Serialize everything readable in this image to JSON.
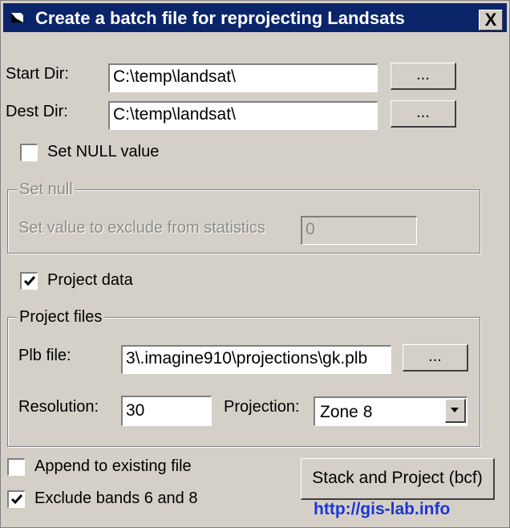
{
  "window": {
    "title": "Create a batch file for reprojecting Landsats",
    "close_label": "X"
  },
  "start_dir": {
    "label": "Start Dir:",
    "value": "C:\\temp\\landsat\\",
    "browse_label": "..."
  },
  "dest_dir": {
    "label": "Dest Dir:",
    "value": "C:\\temp\\landsat\\",
    "browse_label": "..."
  },
  "set_null_checkbox": {
    "label": "Set NULL value",
    "checked": false
  },
  "set_null_group": {
    "legend": "Set null",
    "exclude_label": "Set value to exclude from statistics",
    "exclude_value": "0"
  },
  "project_data_checkbox": {
    "label": "Project data",
    "checked": true
  },
  "project_files_group": {
    "legend": "Project files",
    "plb_label": "Plb file:",
    "plb_value": "3\\.imagine910\\projections\\gk.plb",
    "plb_browse_label": "...",
    "resolution_label": "Resolution:",
    "resolution_value": "30",
    "projection_label": "Projection:",
    "projection_selected": "Zone 8"
  },
  "append_checkbox": {
    "label": "Append to existing file",
    "checked": false
  },
  "exclude_bands_checkbox": {
    "label": "Exclude bands 6 and 8",
    "checked": true
  },
  "stack_button": {
    "label": "Stack and Project (bcf)"
  },
  "watermark": "http://gis-lab.info"
}
